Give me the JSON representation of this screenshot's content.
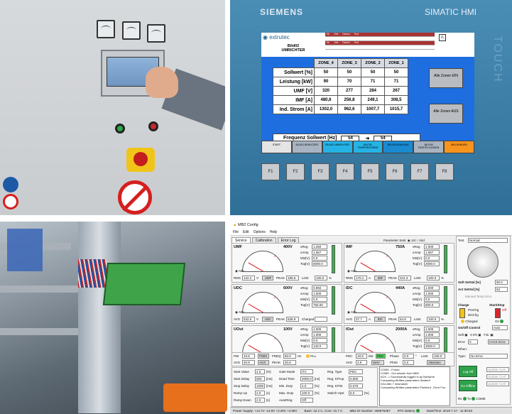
{
  "hmi": {
    "brand": "SIEMENS",
    "model": "SIMATIC HMI",
    "side_label": "TOUCH",
    "logo_text": "extrutec",
    "screen_title": "Bild02",
    "screen_subtitle": "UMRICHTER",
    "alarm_headers": [
      "Nr.",
      "Zeit",
      "Datum",
      "Text"
    ],
    "zones": [
      "ZONE_4",
      "ZONE_3",
      "ZONE_2",
      "ZONE_1"
    ],
    "rows": [
      {
        "label": "Sollwert [%]",
        "values": [
          "50",
          "50",
          "50",
          "50"
        ]
      },
      {
        "label": "Leistung [kW]",
        "values": [
          "90",
          "70",
          "71",
          "71"
        ]
      },
      {
        "label": "UMF [V]",
        "values": [
          "320",
          "277",
          "284",
          "267"
        ]
      },
      {
        "label": "IMF [A]",
        "values": [
          "480,6",
          "256,8",
          "249,1",
          "308,5"
        ]
      },
      {
        "label": "Ind. Strom [A]",
        "values": [
          "1302,0",
          "962,6",
          "1007,7",
          "1015,7"
        ]
      }
    ],
    "freq_label": "Frequenz Sollwert [Hz]",
    "freq_value_left": "54",
    "freq_value_right": "54",
    "btn_zones_on": "Alle Zonen EIN",
    "btn_zones_aus": "Alle Zonen AUS",
    "nav": [
      "START",
      "BILD01 BENUTZER",
      "BILD02 UMRICHTER",
      "BILD03 TEMPERATUREN",
      "BILD04 KÜHLUNG",
      "BILD05 EINSTELLUNGEN",
      "MELDUNGEN"
    ],
    "fkeys": [
      "F1",
      "F2",
      "F3",
      "F4",
      "F5",
      "F6",
      "F7",
      "F8"
    ]
  },
  "app": {
    "title": "MB2 Config",
    "menu": [
      "File",
      "Edit",
      "Options",
      "Help"
    ],
    "tabs": [
      "Service",
      "Calibration",
      "Error Log"
    ],
    "param_sets": "Parameter Sets:",
    "param_1st": "1st",
    "param_2nd": "2nd",
    "meters": [
      {
        "name": "UMF",
        "max": "400V",
        "scale": [
          "0",
          "25",
          "50",
          "75",
          "100"
        ],
        "rms_label": "RMS",
        "rms": "122.2",
        "unit": "V",
        "btn": "UMF",
        "peak_label": "PEAK",
        "peak": "185.6",
        "limit_label": "Limit",
        "limit": "100.0",
        "pct": "%",
        "vreg": "1.250",
        "xamp": "1.067",
        "mn": "0.0",
        "top": "6000.0"
      },
      {
        "name": "IMF",
        "max": "750A",
        "scale": [
          "0",
          "25",
          "50",
          "75",
          "100"
        ],
        "rms_label": "RMS",
        "rms": "170.1",
        "unit": "A",
        "btn": "IMF",
        "peak_label": "PEAK",
        "peak": "341.3",
        "limit_label": "Limit",
        "limit": "100.0",
        "pct": "%",
        "vreg": "1.000",
        "xamp": "1.067",
        "mn": "0.0",
        "top": "2000.0"
      },
      {
        "name": "UDC",
        "max": "600V",
        "scale": [
          "0",
          "25",
          "50",
          "75",
          "100"
        ],
        "rms_label": "AVG",
        "rms": "532.6",
        "unit": "V",
        "btn": "UDC",
        "peak_label": "PEAK",
        "peak": "536.9",
        "limit_label": "Charged",
        "limit": "",
        "pct": "",
        "vreg": "0.992",
        "xamp": "1.000",
        "mn": "0.0",
        "top": "750.00"
      },
      {
        "name": "IDC",
        "max": "440A",
        "scale": [
          "0",
          "25",
          "50",
          "75",
          "100"
        ],
        "rms_label": "AVG",
        "rms": "37.7",
        "unit": "A",
        "btn": "IDC",
        "peak_label": "PEAK",
        "peak": "54.9",
        "limit_label": "Limit",
        "limit": "100.0",
        "pct": "%",
        "vreg": "1.000",
        "xamp": "1.000",
        "mn": "0.0",
        "top": "600.0"
      },
      {
        "name": "UOut",
        "max": "100V",
        "scale": [
          "0",
          "25",
          "50",
          "75",
          "100"
        ],
        "rms_label": "RMS",
        "rms": "0.2",
        "unit": "V",
        "btn": "UOut",
        "peak_label": "PEAK",
        "peak": "3.7",
        "limit_label": "Limit",
        "limit": "100.0",
        "pct": "%",
        "vreg": "1.000",
        "xamp": "1.000",
        "mn": "0.0",
        "top": "140.0"
      },
      {
        "name": "IOut",
        "max": "2000A",
        "scale": [
          "0",
          "25",
          "50",
          "75",
          "100"
        ],
        "rms_label": "RMS",
        "rms": "639.8",
        "unit": "A",
        "btn": "IOut",
        "peak_label": "PEAK",
        "peak": "",
        "limit_label": "Limit",
        "limit": "100.0",
        "pct": "%",
        "vreg": "1.000",
        "xamp": "1.000",
        "mn": "0.0",
        "top": "3000.0"
      }
    ],
    "pwm": {
      "pw_label": "PW",
      "pw": "34.8",
      "btn": "PWM",
      "freq_label": "FREQ",
      "freq": "60.0",
      "hz": "Hz",
      "pll": "PLL",
      "avg_label": "AVG",
      "avg": "40.8",
      "aux": "AUX",
      "peak_label": "PEAK",
      "peak": "40.8"
    },
    "pdc": {
      "pdc_label": "PDC",
      "pdc": "19.9",
      "kw": "kW",
      "btn": "PDC",
      "phase_label": "Phase",
      "phase": "0.0",
      "deg": "°",
      "limit_label": "Limit",
      "limit": "100.0",
      "avg_label": "AVG",
      "avg": "3.9",
      "setv": "SetV",
      "phsir_label": "PhSir",
      "phsir": "0.0",
      "attention": "Attention"
    },
    "settings_left": [
      {
        "label": "Start Value",
        "value": "2.0",
        "unit": "[%]"
      },
      {
        "label": "Start Delay",
        "value": "500",
        "unit": "[ms]"
      },
      {
        "label": "Stop Delay",
        "value": "1000",
        "unit": "[ms]"
      },
      {
        "label": "Ramp Up",
        "value": "2.0",
        "unit": "[s]"
      },
      {
        "label": "Ramp Down",
        "value": "2.0",
        "unit": "[s]"
      }
    ],
    "settings_mid": [
      {
        "label": "Gate Mode",
        "value": "ITn"
      },
      {
        "label": "Dead Time",
        "value": "2000.0",
        "unit": "[ns]"
      },
      {
        "label": "Min. Duty",
        "value": "2.0",
        "unit": "[%]"
      },
      {
        "label": "Max. Duty",
        "value": "100.0",
        "unit": "[%]"
      },
      {
        "label": "AutoRing",
        "value": "Off"
      }
    ],
    "settings_right": [
      {
        "label": "Reg. Type",
        "value": "PDC"
      },
      {
        "label": "Reg. KProp",
        "value": "0.800"
      },
      {
        "label": "Reg. KPint",
        "value": "0.070"
      },
      {
        "label": "Switch Hyst",
        "value": "5.0",
        "unit": "[%]"
      }
    ],
    "log": [
      "COM5 - Found",
      "COM5 - Got answer from MB2",
      "ACK -> Successfully logged in as NoName",
      "Comparing Written parameters Started!",
      "IOut Attn 7 mismatch!",
      "Comparing Written parameters Finished - Error Fou"
    ],
    "right_panel": {
      "test_label": "Test",
      "test_mode": "Normal",
      "soft_setval_label": "Soft SetVal [%]",
      "soft_setval": "50.0",
      "act_setval_label": "Act SetVal [%]",
      "act_setval": "53",
      "manual_temp": "Manual Temp 53.6",
      "charge_label": "Charge",
      "prechg": "PreChg",
      "dischg": "DisChg",
      "charged": "Charged",
      "start_stop_label": "Start/Stop",
      "off": "Off",
      "on": "On",
      "onoff_label": "On/Off Control",
      "onoff_value": "Auto",
      "soft_label": "Soft",
      "duo_label": "0 I/O",
      "fb_label": "F.B.",
      "error_label": "Error",
      "error_value": "0",
      "nack": "nACK Error",
      "when_label": "When:",
      "type_label": "Type:",
      "type_value": "No Error",
      "log_off": "Log Off",
      "go_offline": "Go Offline",
      "update_com": "Update Com",
      "update_conf": "Update Conf",
      "update_conf2": "Update Conf",
      "rx": "Rx",
      "tx": "Tx",
      "com5": "COM5"
    },
    "status": {
      "power_supply": "Power Supply: +14.7V -14.8V +3.29V +4.96V",
      "base": "Base: 42.2 C, Core: 31.7 C",
      "mb2_id": "MB2 ID Number: 456876357",
      "rtc": "RTC Battery",
      "datetime": "Date/Time: 2019.7.17 - 11:30:53"
    }
  }
}
